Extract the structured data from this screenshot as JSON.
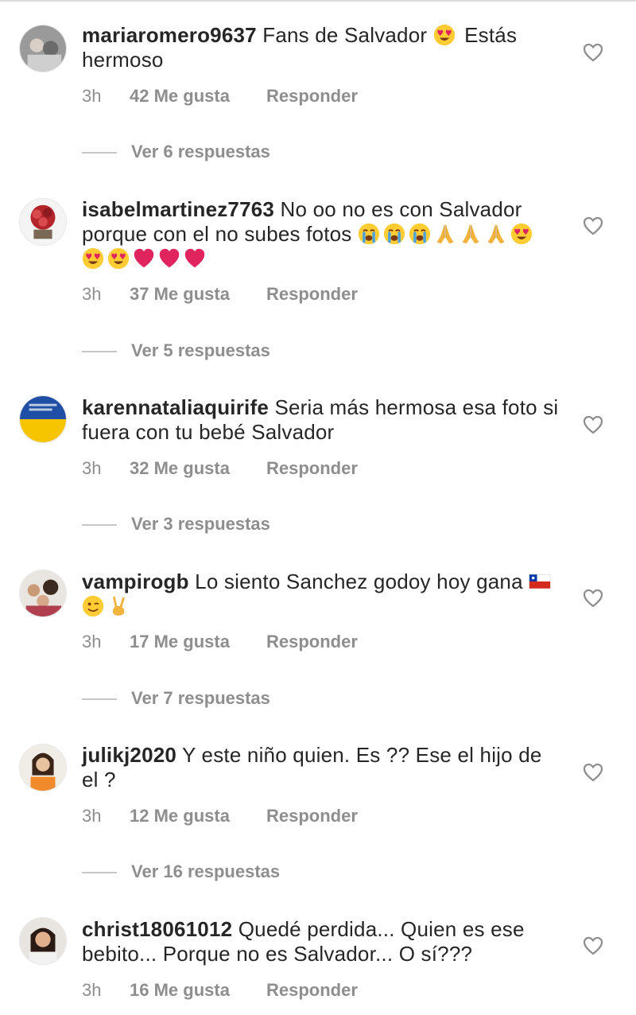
{
  "comments": [
    {
      "username": "mariaromero9637",
      "text": "Fans de Salvador",
      "emojis_after": [
        "heart-eyes-emoji"
      ],
      "text2": "Estás hermoso",
      "time": "3h",
      "likes": "42 Me gusta",
      "reply": "Responder",
      "replies": "Ver 6 respuestas"
    },
    {
      "username": "isabelmartinez7763",
      "text": "No oo no es con Salvador porque con el no subes fotos",
      "emojis": [
        "crying-emoji",
        "crying-emoji",
        "crying-emoji",
        "praying-hands-emoji",
        "praying-hands-emoji",
        "praying-hands-emoji",
        "heart-eyes-emoji",
        "heart-eyes-emoji",
        "heart-eyes-emoji",
        "red-heart-emoji",
        "red-heart-emoji",
        "red-heart-emoji"
      ],
      "time": "3h",
      "likes": "37 Me gusta",
      "reply": "Responder",
      "replies": "Ver 5 respuestas"
    },
    {
      "username": "karennataliaquirife",
      "text": "Seria más hermosa esa foto si fuera con tu bebé Salvador",
      "time": "3h",
      "likes": "32 Me gusta",
      "reply": "Responder",
      "replies": "Ver 3 respuestas"
    },
    {
      "username": "vampirogb",
      "text": "Lo siento Sanchez godoy hoy gana",
      "emojis": [
        "chile-flag-emoji",
        "winking-face-emoji",
        "victory-hand-emoji"
      ],
      "time": "3h",
      "likes": "17 Me gusta",
      "reply": "Responder",
      "replies": "Ver 7 respuestas"
    },
    {
      "username": "julikj2020",
      "text": "Y este niño quien. Es ?? Ese el hijo de el ?",
      "time": "3h",
      "likes": "12 Me gusta",
      "reply": "Responder",
      "replies": "Ver 16 respuestas"
    },
    {
      "username": "christ18061012",
      "text": "Quedé perdida... Quien es ese bebito... Porque no es Salvador... O sí???",
      "time": "3h",
      "likes": "16 Me gusta",
      "reply": "Responder"
    }
  ],
  "icons": {
    "like": "heart-outline-icon"
  },
  "colors": {
    "text": "#262626",
    "meta": "#8e8e8e",
    "divider": "#c7c7c7"
  }
}
